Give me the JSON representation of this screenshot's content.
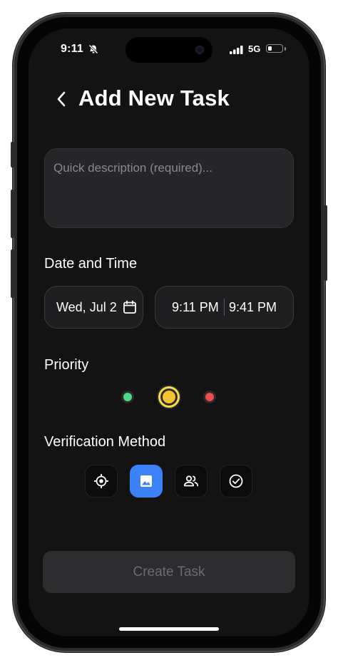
{
  "status_bar": {
    "time": "9:11",
    "network": "5G",
    "battery_level": 0.3
  },
  "header": {
    "title": "Add New Task",
    "back_icon": "chevron-left-icon"
  },
  "description": {
    "value": "",
    "placeholder": "Quick description (required)..."
  },
  "date_time": {
    "label": "Date and Time",
    "date": "Wed, Jul 2",
    "start_time": "9:11 PM",
    "end_time": "9:41 PM"
  },
  "priority": {
    "label": "Priority",
    "options": [
      {
        "name": "low",
        "color": "#4cd98a"
      },
      {
        "name": "medium",
        "color": "#f2c230",
        "selected": true
      },
      {
        "name": "high",
        "color": "#ef4b4b"
      }
    ]
  },
  "verification": {
    "label": "Verification Method",
    "options": [
      {
        "icon": "location-target-icon",
        "selected": false
      },
      {
        "icon": "image-icon",
        "selected": true
      },
      {
        "icon": "people-icon",
        "selected": false
      },
      {
        "icon": "check-circle-icon",
        "selected": false
      }
    ],
    "accent": "#3b82f6"
  },
  "actions": {
    "create_label": "Create Task"
  }
}
